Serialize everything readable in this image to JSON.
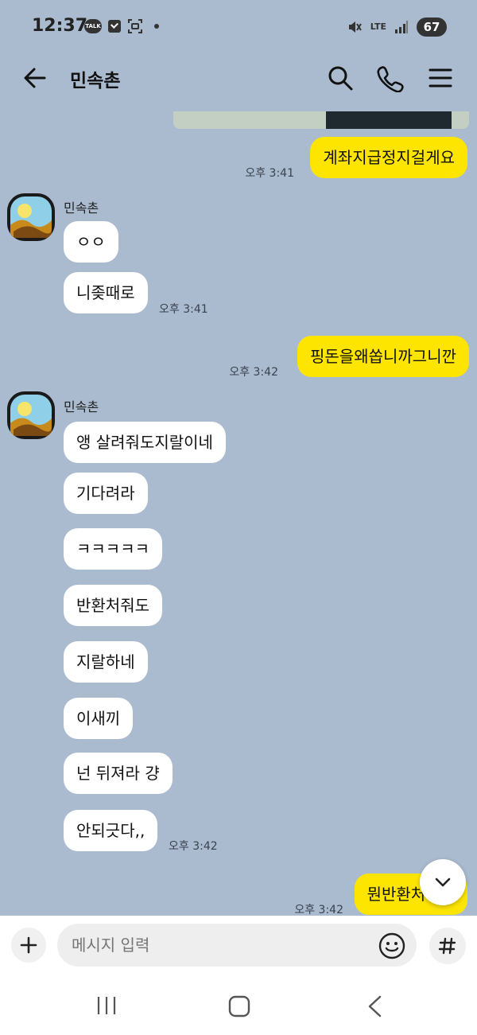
{
  "status_bar": {
    "time": "12:37",
    "talk_badge": "TALK",
    "network": "LTE",
    "battery": "67"
  },
  "header": {
    "title": "민속촌"
  },
  "messages": [
    {
      "side": "mine",
      "text": "계좌지급정지걸게요",
      "time": "오후 3:41"
    },
    {
      "side": "theirs",
      "sender": "민속촌",
      "text": "ㅇㅇ"
    },
    {
      "side": "theirs",
      "text": "니좆때로",
      "time": "오후 3:41"
    },
    {
      "side": "mine",
      "text": "핑돈을왜쏩니까그니깐",
      "time": "오후 3:42"
    },
    {
      "side": "theirs",
      "sender": "민속촌",
      "text": "앵 살려줘도지랄이네"
    },
    {
      "side": "theirs",
      "text": "기다려라"
    },
    {
      "side": "theirs",
      "text": "ㅋㅋㅋㅋㅋ"
    },
    {
      "side": "theirs",
      "text": "반환처줘도"
    },
    {
      "side": "theirs",
      "text": "지랄하네"
    },
    {
      "side": "theirs",
      "text": "이새끼"
    },
    {
      "side": "theirs",
      "text": "넌 뒤져라 걍"
    },
    {
      "side": "theirs",
      "text": "안되긋다,,",
      "time": "오후 3:42"
    },
    {
      "side": "mine",
      "text": "뭔반환처줘요",
      "time": "오후 3:42"
    }
  ],
  "input": {
    "placeholder": "메시지 입력"
  },
  "colors": {
    "background": "#aabbcf",
    "my_bubble": "#fee500",
    "their_bubble": "#ffffff"
  }
}
